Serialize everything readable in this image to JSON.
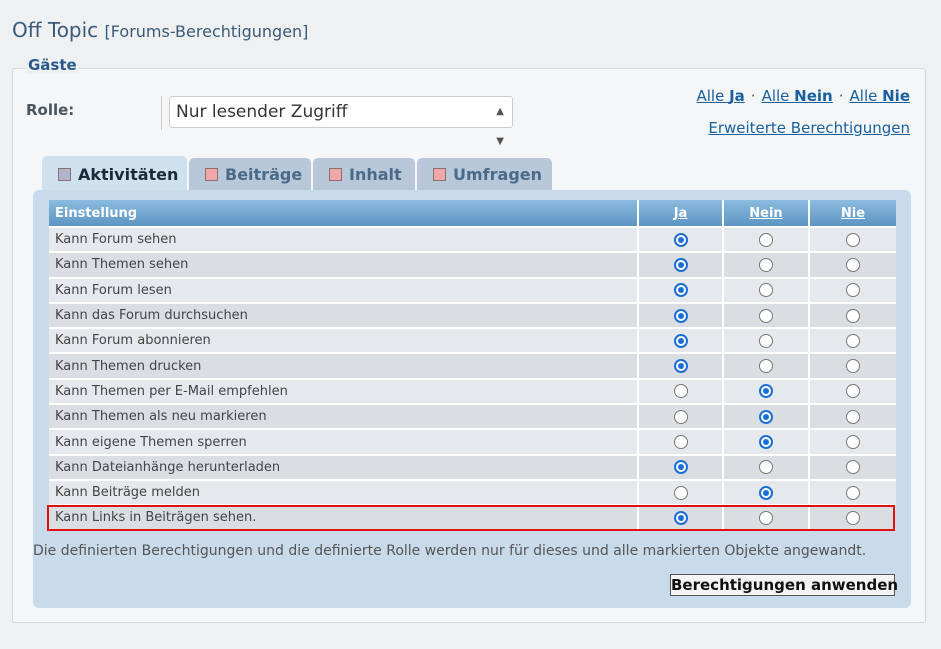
{
  "header": {
    "title": "Off Topic",
    "subtitle": "[Forums-Berechtigungen]"
  },
  "group": {
    "legend": "Gäste"
  },
  "role": {
    "label": "Rolle:",
    "selected": "Nur lesender Zugriff"
  },
  "quick_links": {
    "all_yes_prefix": "Alle",
    "all_yes_word": "Ja",
    "all_no_prefix": "Alle",
    "all_no_word": "Nein",
    "all_never_prefix": "Alle",
    "all_never_word": "Nie",
    "separator": "·",
    "advanced": "Erweiterte Berechtigungen"
  },
  "tabs": [
    {
      "label": "Aktivitäten",
      "active": true,
      "swatch": "#b0b4d0"
    },
    {
      "label": "Beiträge",
      "active": false,
      "swatch": "#f0a8a8"
    },
    {
      "label": "Inhalt",
      "active": false,
      "swatch": "#f0a8a8"
    },
    {
      "label": "Umfragen",
      "active": false,
      "swatch": "#f0a8a8"
    }
  ],
  "table": {
    "headers": {
      "setting": "Einstellung",
      "yes": "Ja",
      "no": "Nein",
      "never": "Nie"
    },
    "rows": [
      {
        "label": "Kann Forum sehen",
        "value": "yes"
      },
      {
        "label": "Kann Themen sehen",
        "value": "yes"
      },
      {
        "label": "Kann Forum lesen",
        "value": "yes"
      },
      {
        "label": "Kann das Forum durchsuchen",
        "value": "yes"
      },
      {
        "label": "Kann Forum abonnieren",
        "value": "yes"
      },
      {
        "label": "Kann Themen drucken",
        "value": "yes"
      },
      {
        "label": "Kann Themen per E-Mail empfehlen",
        "value": "no"
      },
      {
        "label": "Kann Themen als neu markieren",
        "value": "no"
      },
      {
        "label": "Kann eigene Themen sperren",
        "value": "no"
      },
      {
        "label": "Kann Dateianhänge herunterladen",
        "value": "yes"
      },
      {
        "label": "Kann Beiträge melden",
        "value": "no"
      },
      {
        "label": "Kann Links in Beiträgen sehen.",
        "value": "yes",
        "highlighted": true
      }
    ]
  },
  "note": "Die definierten Berechtigungen und die definierte Rolle werden nur für dieses und alle markierten Objekte angewandt.",
  "apply_button": "Berechtigungen anwenden",
  "colors": {
    "highlight_border": "#e01010",
    "radio_selected": "#1a6fd6",
    "header_blue": "#6fa5cf"
  }
}
